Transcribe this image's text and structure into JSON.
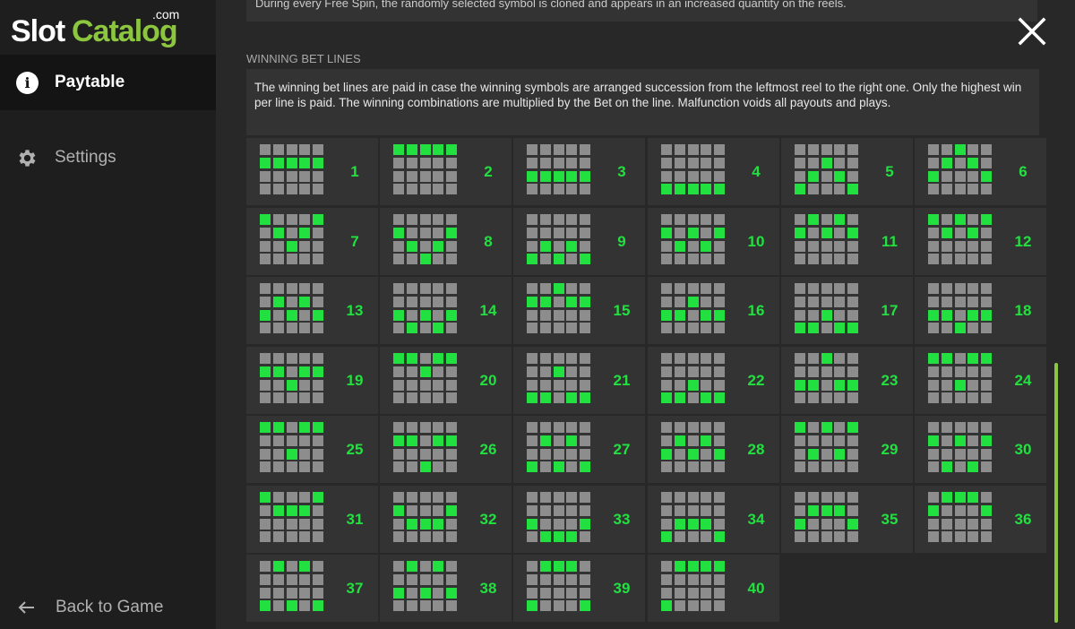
{
  "logo": {
    "part1": "Slot",
    "part2": "Catalog",
    "suffix": ".com"
  },
  "sidebar": {
    "items": [
      {
        "label": "Paytable",
        "icon": "info-icon",
        "active": true
      },
      {
        "label": "Settings",
        "icon": "gear-icon",
        "active": false
      }
    ],
    "back": {
      "label": "Back to Game",
      "icon": "arrow-left-icon"
    }
  },
  "content": {
    "top_text": "During every Free Spin, the randomly selected symbol is cloned and appears in an increased quantity on the reels.",
    "section_title": "WINNING BET LINES",
    "description": "The winning bet lines are paid in case the winning symbols are arranged succession from the leftmost reel to the right one. Only the highest win per line is paid. The winning combinations are multiplied by the Bet on the line. Malfunction voids all payouts and plays."
  },
  "colors": {
    "accent": "#22e040",
    "inactive_square": "#8d8d8d",
    "brand_green": "#8cc63f",
    "panel": "#333333",
    "background": "#282828"
  },
  "grid_shape": {
    "reels": 5,
    "rows": 4
  },
  "lines": [
    {
      "number": "1",
      "rows": [
        1,
        1,
        1,
        1,
        1
      ]
    },
    {
      "number": "2",
      "rows": [
        0,
        0,
        0,
        0,
        0
      ]
    },
    {
      "number": "3",
      "rows": [
        2,
        2,
        2,
        2,
        2
      ]
    },
    {
      "number": "4",
      "rows": [
        3,
        3,
        3,
        3,
        3
      ]
    },
    {
      "number": "5",
      "rows": [
        3,
        2,
        1,
        2,
        3
      ]
    },
    {
      "number": "6",
      "rows": [
        2,
        1,
        0,
        1,
        2
      ]
    },
    {
      "number": "7",
      "rows": [
        0,
        1,
        2,
        1,
        0
      ]
    },
    {
      "number": "8",
      "rows": [
        1,
        2,
        3,
        2,
        1
      ]
    },
    {
      "number": "9",
      "rows": [
        3,
        2,
        3,
        2,
        3
      ]
    },
    {
      "number": "10",
      "rows": [
        1,
        2,
        1,
        2,
        1
      ]
    },
    {
      "number": "11",
      "rows": [
        1,
        0,
        1,
        0,
        1
      ]
    },
    {
      "number": "12",
      "rows": [
        0,
        1,
        0,
        1,
        0
      ]
    },
    {
      "number": "13",
      "rows": [
        2,
        1,
        2,
        1,
        2
      ]
    },
    {
      "number": "14",
      "rows": [
        2,
        3,
        2,
        3,
        2
      ]
    },
    {
      "number": "15",
      "rows": [
        1,
        1,
        0,
        1,
        1
      ]
    },
    {
      "number": "16",
      "rows": [
        2,
        2,
        1,
        2,
        2
      ]
    },
    {
      "number": "17",
      "rows": [
        3,
        3,
        2,
        3,
        3
      ]
    },
    {
      "number": "18",
      "rows": [
        2,
        2,
        3,
        2,
        2
      ]
    },
    {
      "number": "19",
      "rows": [
        1,
        1,
        2,
        1,
        1
      ]
    },
    {
      "number": "20",
      "rows": [
        0,
        0,
        1,
        0,
        0
      ]
    },
    {
      "number": "21",
      "rows": [
        3,
        3,
        1,
        3,
        3
      ]
    },
    {
      "number": "22",
      "rows": [
        3,
        3,
        2,
        3,
        3
      ]
    },
    {
      "number": "23",
      "rows": [
        2,
        2,
        0,
        2,
        2
      ]
    },
    {
      "number": "24",
      "rows": [
        0,
        0,
        2,
        0,
        0
      ]
    },
    {
      "number": "25",
      "rows": [
        0,
        0,
        2,
        0,
        0
      ]
    },
    {
      "number": "26",
      "rows": [
        1,
        1,
        3,
        1,
        1
      ]
    },
    {
      "number": "27",
      "rows": [
        3,
        1,
        3,
        1,
        3
      ]
    },
    {
      "number": "28",
      "rows": [
        2,
        1,
        2,
        1,
        2
      ]
    },
    {
      "number": "29",
      "rows": [
        0,
        2,
        0,
        2,
        0
      ]
    },
    {
      "number": "30",
      "rows": [
        1,
        3,
        1,
        3,
        1
      ]
    },
    {
      "number": "31",
      "rows": [
        0,
        1,
        1,
        1,
        0
      ]
    },
    {
      "number": "32",
      "rows": [
        1,
        2,
        2,
        2,
        1
      ]
    },
    {
      "number": "33",
      "rows": [
        2,
        3,
        3,
        3,
        2
      ]
    },
    {
      "number": "34",
      "rows": [
        3,
        2,
        2,
        2,
        3
      ]
    },
    {
      "number": "35",
      "rows": [
        2,
        1,
        1,
        1,
        2
      ]
    },
    {
      "number": "36",
      "rows": [
        1,
        0,
        0,
        0,
        1
      ]
    },
    {
      "number": "37",
      "rows": [
        3,
        0,
        3,
        0,
        3
      ]
    },
    {
      "number": "38",
      "rows": [
        2,
        0,
        2,
        0,
        2
      ]
    },
    {
      "number": "39",
      "rows": [
        3,
        0,
        0,
        0,
        3
      ]
    },
    {
      "number": "40",
      "rows": [
        3,
        0,
        0,
        0,
        0
      ]
    }
  ]
}
